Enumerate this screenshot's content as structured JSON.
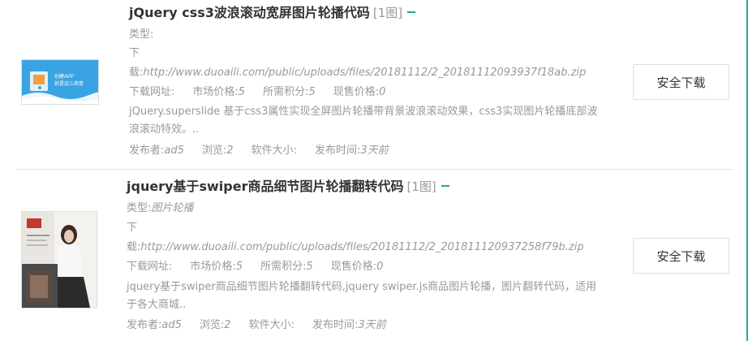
{
  "items": [
    {
      "title": "jQuery css3波浪滚动宽屏图片轮播代码",
      "count": "[1图]",
      "type_label": "类型:",
      "type_value": "",
      "dl_prefix": "下",
      "dl_label": "载:",
      "dl_url": "http://www.duoaili.com/public/uploads/files/20181112/2_20181112093937f18ab.zip",
      "site_label": "下载网址:",
      "market_label": "市场价格:",
      "market_value": "5",
      "points_label": "所需积分:",
      "points_value": "5",
      "current_label": "现售价格:",
      "current_value": "0",
      "description": "jQuery.superslide 基于css3属性实现全屏图片轮播带背景波浪滚动效果，css3实现图片轮播底部波浪滚动特效。..",
      "author_label": "发布者:",
      "author_value": "ad5",
      "views_label": "浏览:",
      "views_value": "2",
      "size_label": "软件大小:",
      "size_value": "",
      "time_label": "发布时间:",
      "time_value": "3天前",
      "button": "安全下载",
      "thumb_text": [
        "创建APP",
        "就是这么简单"
      ],
      "thumb_colors": {
        "bg": "#3aa3e3",
        "wave": "#ffffff"
      }
    },
    {
      "title": "jquery基于swiper商品细节图片轮播翻转代码",
      "count": "[1图]",
      "type_label": "类型:",
      "type_value": "图片轮播",
      "dl_prefix": "下",
      "dl_label": "载:",
      "dl_url": "http://www.duoaili.com/public/uploads/files/20181112/2_201811120937258f79b.zip",
      "site_label": "下载网址:",
      "market_label": "市场价格:",
      "market_value": "5",
      "points_label": "所需积分:",
      "points_value": "5",
      "current_label": "现售价格:",
      "current_value": "0",
      "description": "jquery基于swiper商品细节图片轮播翻转代码,jquery swiper.js商品图片轮播，图片翻转代码，适用于各大商城..",
      "author_label": "发布者:",
      "author_value": "ad5",
      "views_label": "浏览:",
      "views_value": "2",
      "size_label": "软件大小:",
      "size_value": "",
      "time_label": "发布时间:",
      "time_value": "3天前",
      "button": "安全下载",
      "thumb_colors": {
        "bg": "#4a4a4a",
        "accent": "#c0392b",
        "skin": "#e8c9b5"
      }
    }
  ],
  "colors": {
    "title": "#333333",
    "meta": "#999999",
    "minus_icon": "#1db463",
    "divider": "#e6e6e6",
    "right_accent": "#2aa7a2"
  },
  "icons": {
    "collapse": "minus-icon"
  }
}
